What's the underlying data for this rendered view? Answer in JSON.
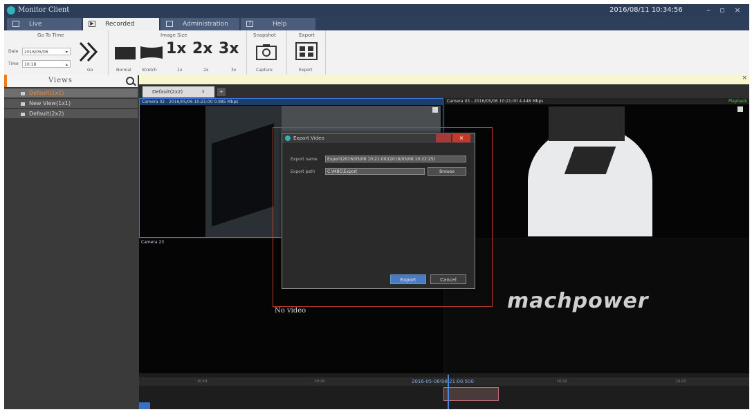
{
  "window": {
    "title": "Monitor Client",
    "clock": "2016/08/11 10:34:56"
  },
  "tabs": [
    {
      "label": "Live"
    },
    {
      "label": "Recorded"
    },
    {
      "label": "Administration"
    },
    {
      "label": "Help"
    }
  ],
  "ribbon": {
    "goto": {
      "group": "Go To Time",
      "date_label": "Date",
      "date_value": "2016/05/06",
      "time_label": "Time",
      "time_value": "10:18",
      "go_label": "Go"
    },
    "image_size": {
      "group": "Image Size",
      "normal": "Normal",
      "stretch": "Stretch",
      "x1": "1x",
      "x2": "2x",
      "x3": "3x",
      "x1_label": "1x",
      "x2_label": "2x",
      "x3_label": "3x"
    },
    "snapshot": {
      "group": "Snapshot",
      "capture": "Capture"
    },
    "export": {
      "group": "Export",
      "export": "Export"
    }
  },
  "sidebar": {
    "title": "Views",
    "items": [
      {
        "label": "Default(1x1)"
      },
      {
        "label": "New View(1x1)"
      },
      {
        "label": "Default(2x2)"
      }
    ]
  },
  "view_tab": {
    "label": "Default(2x2)",
    "close": "x"
  },
  "cameras": [
    {
      "label": "Camera 02 - 2016/05/06 10:21:00 0.985 Mbps"
    },
    {
      "label": "Camera 03 - 2016/05/06 10:21:00 4.448 Mbps",
      "status": "Playback"
    },
    {
      "label": "Camera 23",
      "novideo": "No video"
    }
  ],
  "watermark": "machpower",
  "dialog": {
    "title": "Export Video",
    "name_label": "Export name",
    "name_value": "Export(2016/05/06 10:21:00)(2016/05/06 10:22:25)",
    "path_label": "Export path",
    "path_value": "C:\\MBC\\Export",
    "browse": "Browse",
    "export": "Export",
    "cancel": "Cancel"
  },
  "timeline": {
    "ticks": [
      "10:19",
      "10:20",
      "10:21",
      "10:22",
      "10:23"
    ],
    "current": "2016-05-06 10:21:00.500"
  }
}
